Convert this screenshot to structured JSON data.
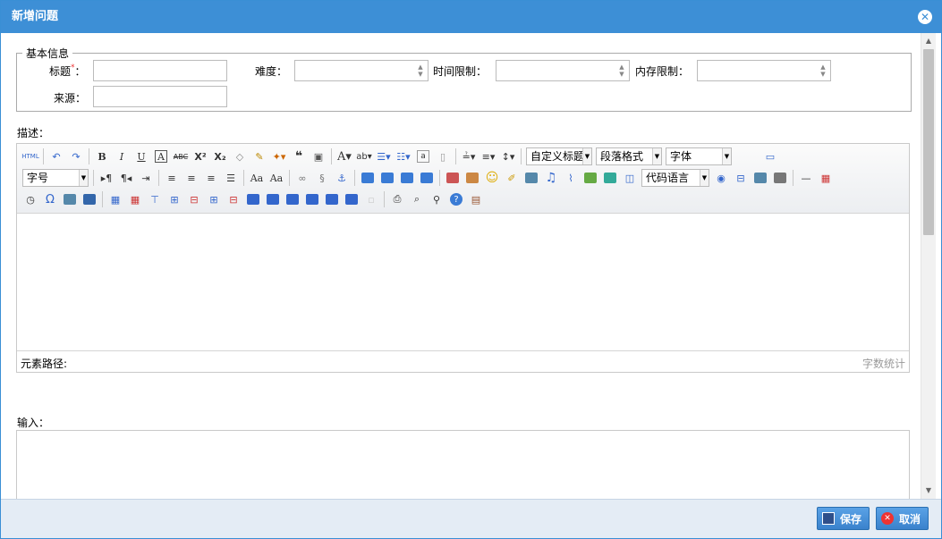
{
  "dialog": {
    "title": "新增问题",
    "close_glyph": "✕"
  },
  "basic": {
    "legend": "基本信息",
    "title_label": "标题",
    "title_required": "*",
    "title_colon": "：",
    "difficulty_label": "难度：",
    "time_label": "时间限制：",
    "memory_label": "内存限制：",
    "source_label": "来源："
  },
  "description": {
    "label": "描述：",
    "toolbar": {
      "custom_title": "自定义标题",
      "paragraph": "段落格式",
      "font": "字体",
      "font_size": "字号",
      "code_lang": "代码语言"
    },
    "status_path": "元素路径:",
    "word_count": "字数统计"
  },
  "input": {
    "label": "输入："
  },
  "footer": {
    "save": "保存",
    "cancel": "取消"
  }
}
